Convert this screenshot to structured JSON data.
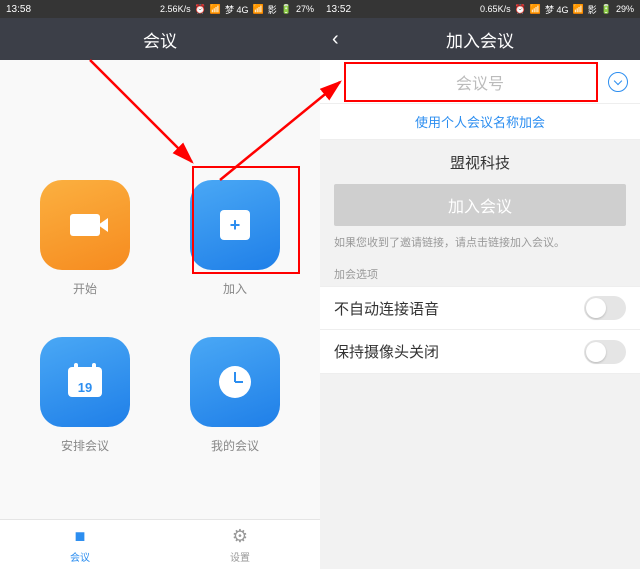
{
  "left": {
    "status": {
      "time": "13:58",
      "speed": "2.56K/s",
      "carrier1": "梦 4G",
      "carrier2": "影",
      "battery": "27%"
    },
    "nav": {
      "title": "会议"
    },
    "buttons": {
      "start": "开始",
      "join": "加入",
      "schedule": "安排会议",
      "mine": "我的会议",
      "calendar_day": "19"
    },
    "tabs": {
      "meeting": "会议",
      "settings": "设置"
    }
  },
  "right": {
    "status": {
      "time": "13:52",
      "speed": "0.65K/s",
      "carrier1": "梦 4G",
      "carrier2": "影",
      "battery": "29%"
    },
    "nav": {
      "title": "加入会议"
    },
    "input_placeholder": "会议号",
    "personal_link": "使用个人会议名称加会",
    "display_name": "盟视科技",
    "join_button": "加入会议",
    "hint": "如果您收到了邀请链接，请点击链接加入会议。",
    "options_label": "加会选项",
    "opt_audio": "不自动连接语音",
    "opt_camera": "保持摄像头关闭"
  }
}
